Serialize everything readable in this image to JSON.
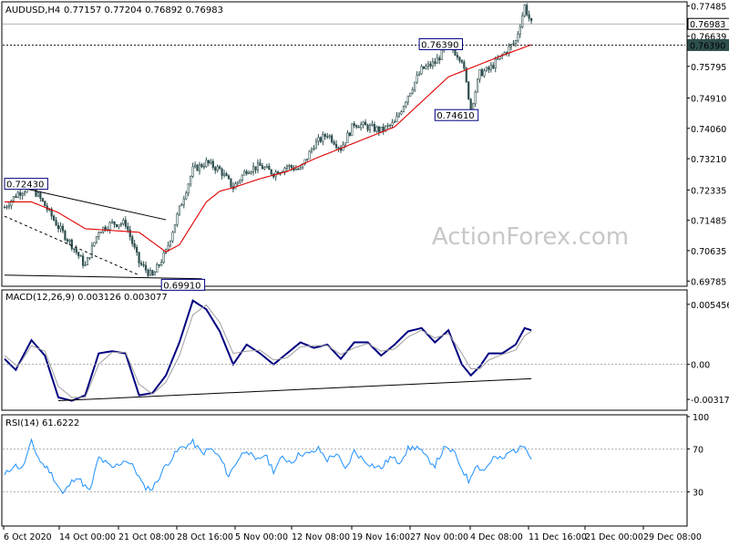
{
  "chart_data": [
    {
      "type": "candlestick",
      "panel": "price",
      "header": {
        "symbol": "AUDUSD,H4",
        "ohlc": "0.77157 0.77204 0.76892 0.76983"
      },
      "y_tick_labels": [
        "0.77485",
        "0.76983",
        "0.76639",
        "0.76390",
        "0.75795",
        "0.74910",
        "0.74060",
        "0.73210",
        "0.72335",
        "0.71485",
        "0.70635",
        "0.69785"
      ],
      "y_ticks": [
        0.77485,
        0.76639,
        0.75795,
        0.7491,
        0.7406,
        0.7321,
        0.72335,
        0.71485,
        0.70635,
        0.69785
      ],
      "ylim": [
        0.6969,
        0.7755
      ],
      "current_price": 0.76983,
      "current_price_label": "0.76983",
      "hline_level": 0.7639,
      "hline_label": "0.76390",
      "annotations": [
        {
          "label": "0.72430",
          "value": 0.7243
        },
        {
          "label": "0.69910",
          "value": 0.6991
        },
        {
          "label": "0.76390",
          "value": 0.7639
        },
        {
          "label": "0.74610",
          "value": 0.7461
        }
      ],
      "path_points": [
        {
          "i": 0,
          "v": 0.7185
        },
        {
          "i": 6,
          "v": 0.7225
        },
        {
          "i": 12,
          "v": 0.7243
        },
        {
          "i": 18,
          "v": 0.719
        },
        {
          "i": 24,
          "v": 0.713
        },
        {
          "i": 30,
          "v": 0.708
        },
        {
          "i": 36,
          "v": 0.702
        },
        {
          "i": 42,
          "v": 0.712
        },
        {
          "i": 48,
          "v": 0.714
        },
        {
          "i": 54,
          "v": 0.714
        },
        {
          "i": 60,
          "v": 0.703
        },
        {
          "i": 66,
          "v": 0.6991
        },
        {
          "i": 72,
          "v": 0.706
        },
        {
          "i": 78,
          "v": 0.718
        },
        {
          "i": 84,
          "v": 0.729
        },
        {
          "i": 90,
          "v": 0.731
        },
        {
          "i": 96,
          "v": 0.729
        },
        {
          "i": 102,
          "v": 0.724
        },
        {
          "i": 108,
          "v": 0.729
        },
        {
          "i": 114,
          "v": 0.73
        },
        {
          "i": 120,
          "v": 0.728
        },
        {
          "i": 126,
          "v": 0.73
        },
        {
          "i": 132,
          "v": 0.729
        },
        {
          "i": 138,
          "v": 0.736
        },
        {
          "i": 144,
          "v": 0.739
        },
        {
          "i": 150,
          "v": 0.735
        },
        {
          "i": 156,
          "v": 0.742
        },
        {
          "i": 162,
          "v": 0.741
        },
        {
          "i": 168,
          "v": 0.74
        },
        {
          "i": 174,
          "v": 0.742
        },
        {
          "i": 180,
          "v": 0.75
        },
        {
          "i": 186,
          "v": 0.757
        },
        {
          "i": 192,
          "v": 0.759
        },
        {
          "i": 198,
          "v": 0.7639
        },
        {
          "i": 204,
          "v": 0.76
        },
        {
          "i": 208,
          "v": 0.7461
        },
        {
          "i": 212,
          "v": 0.756
        },
        {
          "i": 216,
          "v": 0.757
        },
        {
          "i": 222,
          "v": 0.761
        },
        {
          "i": 228,
          "v": 0.765
        },
        {
          "i": 232,
          "v": 0.7748
        },
        {
          "i": 235,
          "v": 0.7698
        }
      ],
      "ma_path_points": [
        {
          "i": 0,
          "v": 0.72
        },
        {
          "i": 12,
          "v": 0.72
        },
        {
          "i": 24,
          "v": 0.717
        },
        {
          "i": 36,
          "v": 0.7125
        },
        {
          "i": 48,
          "v": 0.712
        },
        {
          "i": 60,
          "v": 0.7115
        },
        {
          "i": 72,
          "v": 0.706
        },
        {
          "i": 78,
          "v": 0.708
        },
        {
          "i": 84,
          "v": 0.714
        },
        {
          "i": 90,
          "v": 0.72
        },
        {
          "i": 96,
          "v": 0.723
        },
        {
          "i": 102,
          "v": 0.724
        },
        {
          "i": 114,
          "v": 0.7265
        },
        {
          "i": 126,
          "v": 0.7285
        },
        {
          "i": 138,
          "v": 0.732
        },
        {
          "i": 150,
          "v": 0.735
        },
        {
          "i": 162,
          "v": 0.738
        },
        {
          "i": 174,
          "v": 0.741
        },
        {
          "i": 186,
          "v": 0.748
        },
        {
          "i": 198,
          "v": 0.755
        },
        {
          "i": 210,
          "v": 0.758
        },
        {
          "i": 222,
          "v": 0.761
        },
        {
          "i": 235,
          "v": 0.764
        }
      ],
      "trend_lines": [
        {
          "from": {
            "i": 0,
            "v": 0.725
          },
          "to": {
            "i": 72,
            "v": 0.715
          },
          "style": "solid"
        },
        {
          "from": {
            "i": 0,
            "v": 0.716
          },
          "to": {
            "i": 60,
            "v": 0.6995
          },
          "style": "dashed"
        },
        {
          "from": {
            "i": 0,
            "v": 0.6995
          },
          "to": {
            "i": 88,
            "v": 0.6985
          },
          "style": "solid"
        }
      ],
      "watermark": "ActionForex.com",
      "grid": false
    },
    {
      "type": "line",
      "panel": "macd",
      "header": "MACD(12,26,9) 0.003126 0.003077",
      "y_tick_labels": [
        "0.005456",
        "0.00",
        "-0.003178"
      ],
      "y_ticks": [
        0.005456,
        0.0,
        -0.003178
      ],
      "ylim": [
        -0.004,
        0.0066
      ],
      "series": [
        {
          "name": "MACD",
          "color": "#000080",
          "points": [
            {
              "i": 0,
              "v": 0.0005
            },
            {
              "i": 5,
              "v": -0.0005
            },
            {
              "i": 12,
              "v": 0.0022
            },
            {
              "i": 18,
              "v": 0.0008
            },
            {
              "i": 24,
              "v": -0.003
            },
            {
              "i": 30,
              "v": -0.0033
            },
            {
              "i": 36,
              "v": -0.0028
            },
            {
              "i": 42,
              "v": 0.001
            },
            {
              "i": 48,
              "v": 0.0012
            },
            {
              "i": 54,
              "v": 0.001
            },
            {
              "i": 60,
              "v": -0.0028
            },
            {
              "i": 66,
              "v": -0.0026
            },
            {
              "i": 72,
              "v": -0.001
            },
            {
              "i": 78,
              "v": 0.002
            },
            {
              "i": 84,
              "v": 0.0058
            },
            {
              "i": 90,
              "v": 0.005
            },
            {
              "i": 96,
              "v": 0.003
            },
            {
              "i": 102,
              "v": 0.0
            },
            {
              "i": 108,
              "v": 0.0018
            },
            {
              "i": 114,
              "v": 0.001
            },
            {
              "i": 120,
              "v": 0.0
            },
            {
              "i": 126,
              "v": 0.001
            },
            {
              "i": 132,
              "v": 0.002
            },
            {
              "i": 138,
              "v": 0.0015
            },
            {
              "i": 144,
              "v": 0.0018
            },
            {
              "i": 150,
              "v": 0.0005
            },
            {
              "i": 156,
              "v": 0.002
            },
            {
              "i": 162,
              "v": 0.002
            },
            {
              "i": 168,
              "v": 0.0008
            },
            {
              "i": 174,
              "v": 0.0018
            },
            {
              "i": 180,
              "v": 0.003
            },
            {
              "i": 186,
              "v": 0.0033
            },
            {
              "i": 192,
              "v": 0.002
            },
            {
              "i": 198,
              "v": 0.0031
            },
            {
              "i": 204,
              "v": 0.0
            },
            {
              "i": 208,
              "v": -0.001
            },
            {
              "i": 212,
              "v": -0.0002
            },
            {
              "i": 216,
              "v": 0.001
            },
            {
              "i": 222,
              "v": 0.001
            },
            {
              "i": 228,
              "v": 0.0018
            },
            {
              "i": 232,
              "v": 0.0033
            },
            {
              "i": 235,
              "v": 0.0031
            }
          ]
        },
        {
          "name": "Signal",
          "color": "#a0a0a0",
          "points": [
            {
              "i": 0,
              "v": 0.0008
            },
            {
              "i": 6,
              "v": -0.0002
            },
            {
              "i": 12,
              "v": 0.0017
            },
            {
              "i": 18,
              "v": 0.0012
            },
            {
              "i": 24,
              "v": -0.002
            },
            {
              "i": 30,
              "v": -0.003
            },
            {
              "i": 36,
              "v": -0.003
            },
            {
              "i": 42,
              "v": 0.0
            },
            {
              "i": 48,
              "v": 0.0011
            },
            {
              "i": 54,
              "v": 0.0011
            },
            {
              "i": 60,
              "v": -0.0018
            },
            {
              "i": 66,
              "v": -0.0027
            },
            {
              "i": 72,
              "v": -0.0016
            },
            {
              "i": 78,
              "v": 0.0008
            },
            {
              "i": 84,
              "v": 0.0045
            },
            {
              "i": 90,
              "v": 0.0054
            },
            {
              "i": 96,
              "v": 0.0038
            },
            {
              "i": 102,
              "v": 0.001
            },
            {
              "i": 108,
              "v": 0.0012
            },
            {
              "i": 114,
              "v": 0.0013
            },
            {
              "i": 120,
              "v": 0.0004
            },
            {
              "i": 126,
              "v": 0.0006
            },
            {
              "i": 132,
              "v": 0.0016
            },
            {
              "i": 138,
              "v": 0.0017
            },
            {
              "i": 144,
              "v": 0.0017
            },
            {
              "i": 150,
              "v": 0.0009
            },
            {
              "i": 156,
              "v": 0.0015
            },
            {
              "i": 162,
              "v": 0.0019
            },
            {
              "i": 168,
              "v": 0.0012
            },
            {
              "i": 174,
              "v": 0.0014
            },
            {
              "i": 180,
              "v": 0.0025
            },
            {
              "i": 186,
              "v": 0.0031
            },
            {
              "i": 192,
              "v": 0.0024
            },
            {
              "i": 198,
              "v": 0.0028
            },
            {
              "i": 204,
              "v": 0.001
            },
            {
              "i": 208,
              "v": -0.0004
            },
            {
              "i": 212,
              "v": -0.0004
            },
            {
              "i": 216,
              "v": 0.0004
            },
            {
              "i": 222,
              "v": 0.0009
            },
            {
              "i": 228,
              "v": 0.0013
            },
            {
              "i": 232,
              "v": 0.0026
            },
            {
              "i": 235,
              "v": 0.003
            }
          ]
        }
      ],
      "trend_lines": [
        {
          "from": {
            "i": 24,
            "v": -0.0033
          },
          "to": {
            "i": 235,
            "v": -0.0013
          },
          "style": "solid"
        }
      ],
      "grid": false
    },
    {
      "type": "line",
      "panel": "rsi",
      "header": "RSI(14) 61.6222",
      "y_tick_labels": [
        "100",
        "70",
        "30"
      ],
      "y_ticks": [
        100,
        70,
        30
      ],
      "ylim": [
        0,
        100
      ],
      "levels": [
        70,
        30
      ],
      "series": [
        {
          "name": "RSI(14)",
          "color": "#1e90ff",
          "points": [
            {
              "i": 0,
              "v": 45
            },
            {
              "i": 4,
              "v": 55
            },
            {
              "i": 8,
              "v": 52
            },
            {
              "i": 12,
              "v": 76
            },
            {
              "i": 16,
              "v": 58
            },
            {
              "i": 20,
              "v": 50
            },
            {
              "i": 26,
              "v": 28
            },
            {
              "i": 32,
              "v": 45
            },
            {
              "i": 38,
              "v": 30
            },
            {
              "i": 42,
              "v": 62
            },
            {
              "i": 48,
              "v": 52
            },
            {
              "i": 54,
              "v": 60
            },
            {
              "i": 58,
              "v": 52
            },
            {
              "i": 62,
              "v": 35
            },
            {
              "i": 66,
              "v": 33
            },
            {
              "i": 72,
              "v": 55
            },
            {
              "i": 78,
              "v": 70
            },
            {
              "i": 84,
              "v": 76
            },
            {
              "i": 88,
              "v": 66
            },
            {
              "i": 92,
              "v": 70
            },
            {
              "i": 96,
              "v": 62
            },
            {
              "i": 100,
              "v": 45
            },
            {
              "i": 104,
              "v": 60
            },
            {
              "i": 108,
              "v": 70
            },
            {
              "i": 112,
              "v": 58
            },
            {
              "i": 116,
              "v": 65
            },
            {
              "i": 120,
              "v": 50
            },
            {
              "i": 124,
              "v": 62
            },
            {
              "i": 128,
              "v": 58
            },
            {
              "i": 132,
              "v": 66
            },
            {
              "i": 136,
              "v": 65
            },
            {
              "i": 140,
              "v": 70
            },
            {
              "i": 144,
              "v": 60
            },
            {
              "i": 148,
              "v": 66
            },
            {
              "i": 152,
              "v": 50
            },
            {
              "i": 156,
              "v": 68
            },
            {
              "i": 160,
              "v": 60
            },
            {
              "i": 164,
              "v": 55
            },
            {
              "i": 168,
              "v": 52
            },
            {
              "i": 172,
              "v": 62
            },
            {
              "i": 176,
              "v": 58
            },
            {
              "i": 180,
              "v": 70
            },
            {
              "i": 184,
              "v": 72
            },
            {
              "i": 188,
              "v": 62
            },
            {
              "i": 192,
              "v": 55
            },
            {
              "i": 196,
              "v": 70
            },
            {
              "i": 200,
              "v": 68
            },
            {
              "i": 204,
              "v": 52
            },
            {
              "i": 207,
              "v": 40
            },
            {
              "i": 210,
              "v": 55
            },
            {
              "i": 214,
              "v": 50
            },
            {
              "i": 218,
              "v": 62
            },
            {
              "i": 222,
              "v": 60
            },
            {
              "i": 226,
              "v": 68
            },
            {
              "i": 230,
              "v": 70
            },
            {
              "i": 232,
              "v": 75
            },
            {
              "i": 235,
              "v": 62
            }
          ]
        }
      ],
      "grid": false
    }
  ],
  "x_axis": {
    "n_bars": 236,
    "tick_labels": [
      {
        "label": "6 Oct 2020",
        "i": 0
      },
      {
        "label": "14 Oct 00:00",
        "i": 29
      },
      {
        "label": "21 Oct 08:00",
        "i": 56
      },
      {
        "label": "28 Oct 16:00",
        "i": 85
      },
      {
        "label": "5 Nov 00:00",
        "i": 113
      },
      {
        "label": "12 Nov 08:00",
        "i": 140
      },
      {
        "label": "19 Nov 16:00",
        "i": 167
      },
      {
        "label": "27 Nov 00:00",
        "i": 194
      },
      {
        "label": "4 Dec 08:00",
        "i": 222
      },
      {
        "label": "11 Dec 16:00",
        "i": 250
      },
      {
        "label": "21 Dec 00:00",
        "i": 277
      },
      {
        "label": "29 Dec 08:00",
        "i": 305
      }
    ]
  },
  "colors": {
    "background": "#ffffff",
    "candle": "#2f4f4f",
    "ma": "#e00000",
    "macd": "#000080",
    "signal": "#a0a0a0",
    "rsi": "#1e90ff",
    "current_price_box": "#000000",
    "annotation_border": "#000080"
  }
}
